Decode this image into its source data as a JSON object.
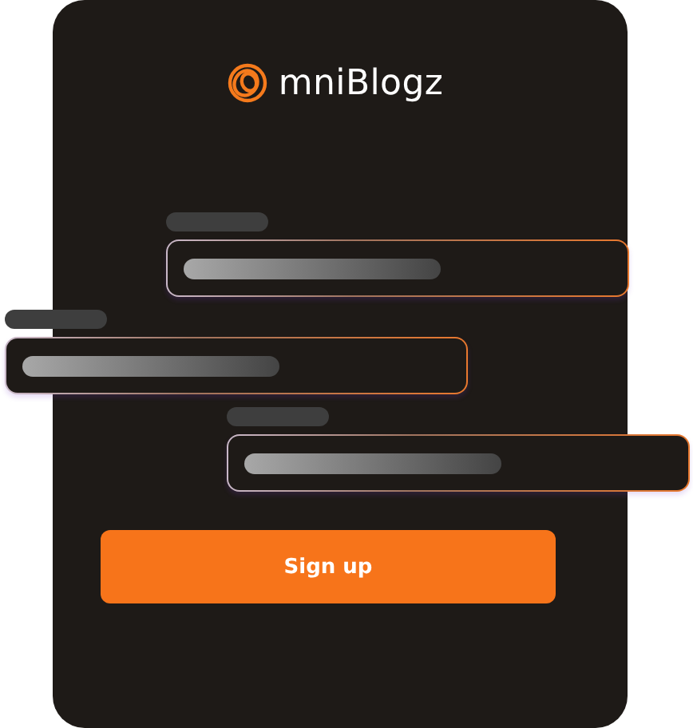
{
  "logo": {
    "name": "mniBlogz"
  },
  "fields": [
    {
      "kind": "skeleton"
    },
    {
      "kind": "skeleton"
    },
    {
      "kind": "skeleton"
    }
  ],
  "button": {
    "label": "Sign up"
  }
}
